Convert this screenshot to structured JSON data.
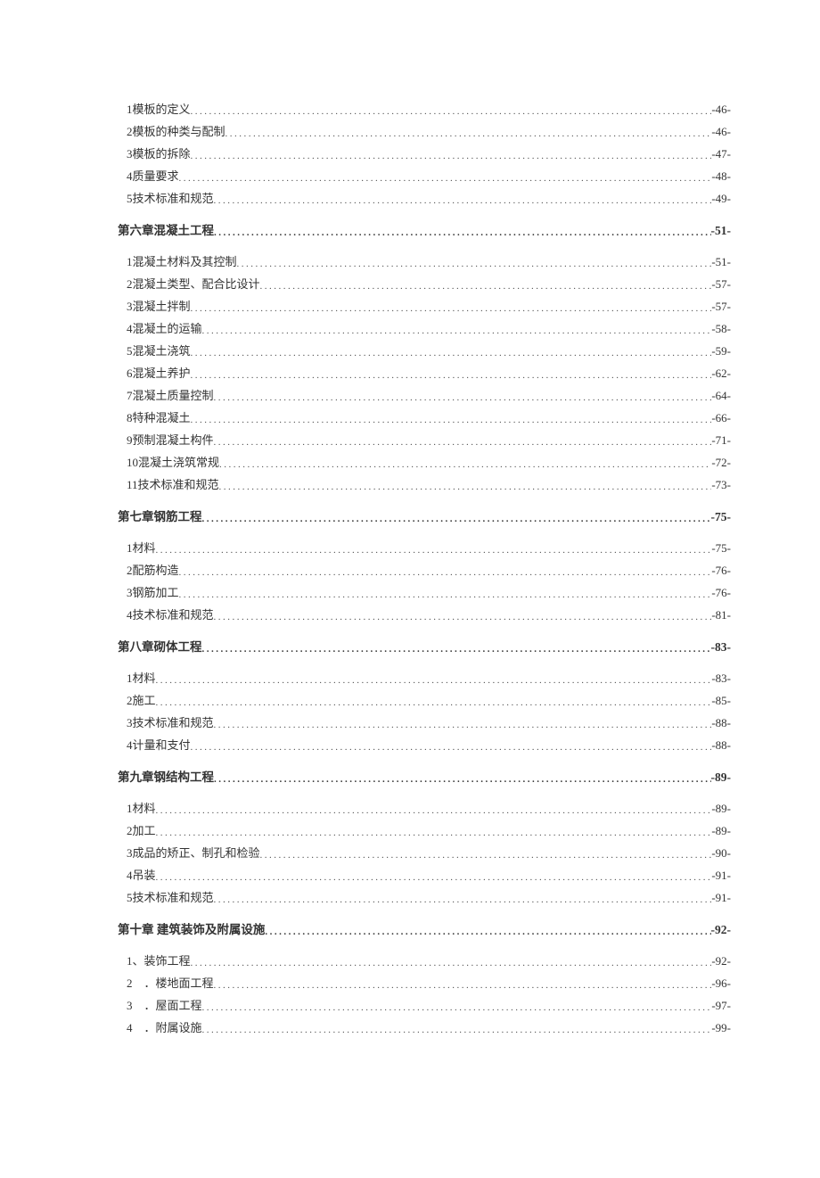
{
  "toc": [
    {
      "level": "sub",
      "title": "1模板的定义",
      "page": "-46-"
    },
    {
      "level": "sub",
      "title": "2模板的种类与配制",
      "page": "-46-"
    },
    {
      "level": "sub",
      "title": "3模板的拆除",
      "page": "-47-"
    },
    {
      "level": "sub",
      "title": "4质量要求",
      "page": "-48-"
    },
    {
      "level": "sub",
      "title": "5技术标准和规范",
      "page": "-49-"
    },
    {
      "level": "chapter",
      "title": "第六章混凝土工程",
      "page": "-51-"
    },
    {
      "level": "sub",
      "title": "1混凝土材料及其控制",
      "page": "-51-"
    },
    {
      "level": "sub",
      "title": "2混凝土类型、配合比设计",
      "page": "-57-"
    },
    {
      "level": "sub",
      "title": "3混凝土拌制",
      "page": "-57-"
    },
    {
      "level": "sub",
      "title": "4混凝土的运输",
      "page": "-58-"
    },
    {
      "level": "sub",
      "title": "5混凝土浇筑",
      "page": "-59-"
    },
    {
      "level": "sub",
      "title": "6混凝土养护",
      "page": "-62-"
    },
    {
      "level": "sub",
      "title": "7混凝土质量控制",
      "page": "-64-"
    },
    {
      "level": "sub",
      "title": "8特种混凝土",
      "page": "-66-"
    },
    {
      "level": "sub",
      "title": "9预制混凝土构件",
      "page": "-71-"
    },
    {
      "level": "sub",
      "title": "10混凝土浇筑常规",
      "page": "-72-"
    },
    {
      "level": "sub",
      "title": "11技术标准和规范",
      "page": "-73-"
    },
    {
      "level": "chapter",
      "title": "第七章钢筋工程",
      "page": "-75-"
    },
    {
      "level": "sub",
      "title": "1材料",
      "page": "-75-"
    },
    {
      "level": "sub",
      "title": "2配筋构造",
      "page": "-76-"
    },
    {
      "level": "sub",
      "title": "3钢筋加工",
      "page": "-76-"
    },
    {
      "level": "sub",
      "title": "4技术标准和规范",
      "page": "-81-"
    },
    {
      "level": "chapter",
      "title": "第八章砌体工程",
      "page": "-83-"
    },
    {
      "level": "sub",
      "title": "1材料",
      "page": "-83-"
    },
    {
      "level": "sub",
      "title": "2施工",
      "page": "-85-"
    },
    {
      "level": "sub",
      "title": "3技术标准和规范",
      "page": "-88-"
    },
    {
      "level": "sub",
      "title": "4计量和支付",
      "page": "-88-"
    },
    {
      "level": "chapter",
      "title": "第九章钢结构工程",
      "page": "-89-"
    },
    {
      "level": "sub",
      "title": "1材料",
      "page": "-89-"
    },
    {
      "level": "sub",
      "title": "2加工",
      "page": "-89-"
    },
    {
      "level": "sub",
      "title": "3成品的矫正、制孔和检验",
      "page": "-90-"
    },
    {
      "level": "sub",
      "title": "4吊装",
      "page": "-91-"
    },
    {
      "level": "sub",
      "title": "5技术标准和规范",
      "page": "-91-"
    },
    {
      "level": "chapter",
      "title": "第十章 建筑装饰及附属设施",
      "page": "-92-"
    },
    {
      "level": "sub",
      "title": "1、装饰工程",
      "page": "-92-"
    },
    {
      "level": "sub",
      "title": "2　．楼地面工程",
      "page": "-96-"
    },
    {
      "level": "sub",
      "title": "3　．屋面工程",
      "page": "-97-"
    },
    {
      "level": "sub",
      "title": "4　．附属设施",
      "page": "-99-"
    }
  ]
}
